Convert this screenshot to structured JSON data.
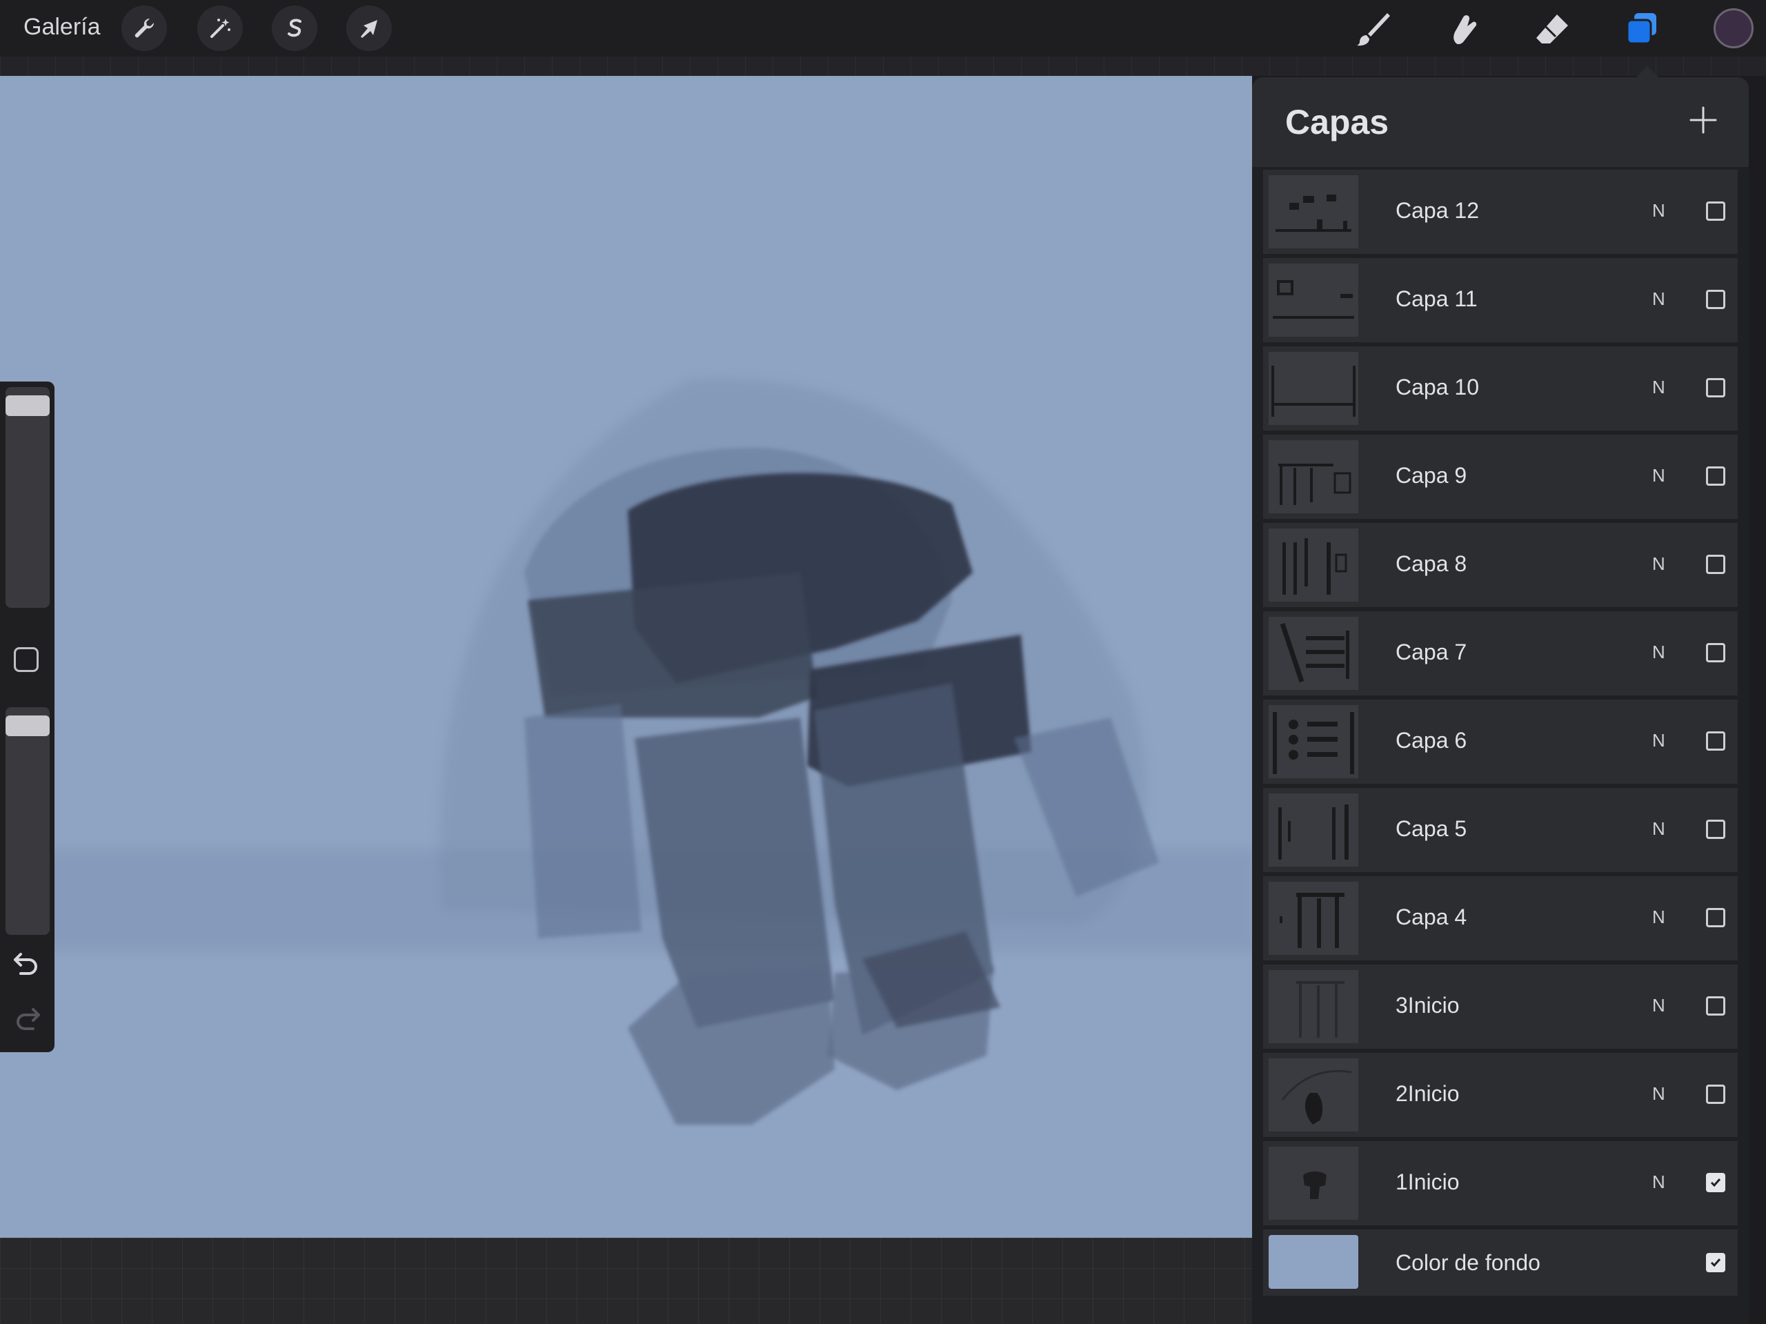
{
  "topbar": {
    "gallery_label": "Galería",
    "left_tools": [
      "wrench-icon",
      "magic-wand-icon",
      "selection-s-icon",
      "transform-arrow-icon"
    ],
    "right_tools": [
      "brush-icon",
      "smudge-icon",
      "eraser-icon",
      "layers-icon"
    ],
    "active_tool_color": "#1a73e8",
    "current_color": "#3a2d44"
  },
  "canvas": {
    "background_color": "#8fa3c2"
  },
  "layers_panel": {
    "title": "Capas",
    "layers": [
      {
        "name": "Capa 12",
        "mode": "N",
        "visible": false
      },
      {
        "name": "Capa 11",
        "mode": "N",
        "visible": false
      },
      {
        "name": "Capa 10",
        "mode": "N",
        "visible": false
      },
      {
        "name": "Capa 9",
        "mode": "N",
        "visible": false
      },
      {
        "name": "Capa 8",
        "mode": "N",
        "visible": false
      },
      {
        "name": "Capa 7",
        "mode": "N",
        "visible": false
      },
      {
        "name": "Capa 6",
        "mode": "N",
        "visible": false
      },
      {
        "name": "Capa 5",
        "mode": "N",
        "visible": false
      },
      {
        "name": "Capa 4",
        "mode": "N",
        "visible": false
      },
      {
        "name": "3Inicio",
        "mode": "N",
        "visible": false
      },
      {
        "name": "2Inicio",
        "mode": "N",
        "visible": false
      },
      {
        "name": "1Inicio",
        "mode": "N",
        "visible": true
      }
    ],
    "background_layer": {
      "name": "Color de fondo",
      "visible": true,
      "color": "#8fa3c2"
    }
  }
}
